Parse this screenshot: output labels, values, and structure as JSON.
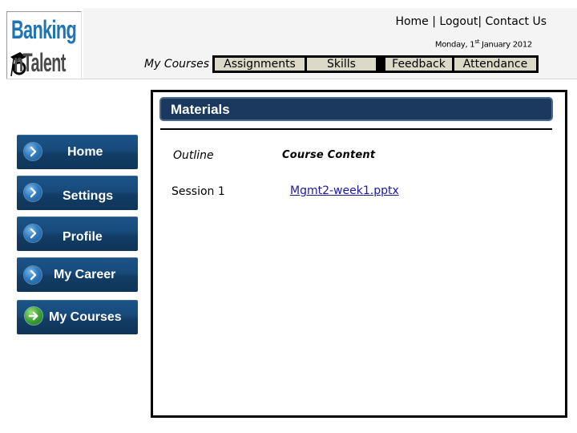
{
  "logo": {
    "line1": "Banking",
    "line2": "nTalent"
  },
  "header": {
    "links": [
      "Home",
      "Logout",
      "Contact Us"
    ],
    "separator": "|",
    "date_prefix": "Monday, 1",
    "date_suffix_sup": "st",
    "date_rest": " January 2012"
  },
  "tabs": {
    "active": "My Courses",
    "items": [
      "Assignments",
      "Skills",
      "Feedback",
      "Attendance"
    ]
  },
  "content": {
    "section_title": "Materials",
    "columns": [
      "Outline",
      "Course Content"
    ],
    "rows": [
      {
        "outline": "Session 1",
        "file": "Mgmt2-week1.pptx"
      }
    ]
  },
  "sidebar": {
    "items": [
      {
        "label": "Home",
        "icon": "chevron-right-icon",
        "active": false
      },
      {
        "label": "Settings",
        "icon": "chevron-right-icon",
        "active": false
      },
      {
        "label": "Profile",
        "icon": "chevron-right-icon",
        "active": false
      },
      {
        "label": "My Career",
        "icon": "chevron-right-icon",
        "active": false
      },
      {
        "label": "My Courses",
        "icon": "arrow-right-icon",
        "active": true
      }
    ]
  },
  "colors": {
    "nav_blue": "#174a7a",
    "materials_bar": "#1b385e",
    "tab_bg": "#ddd9c8",
    "link": "#1a1aa6",
    "logo_blue": "#1f74b5",
    "active_icon_green": "#3ea535"
  }
}
